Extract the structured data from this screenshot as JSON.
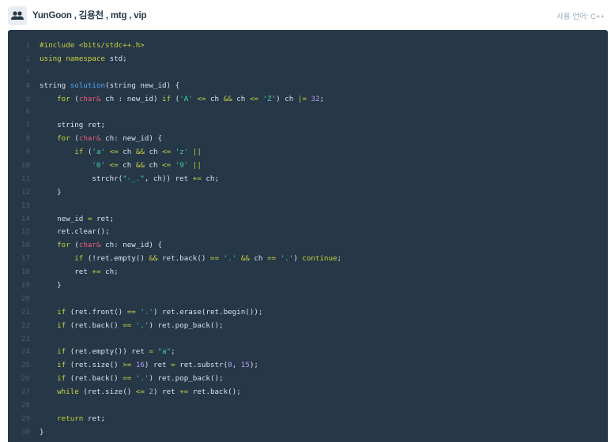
{
  "header": {
    "authors": "YunGoon , 김용천 , mtg , vip",
    "language_label": "사용 언어: C++"
  },
  "code": {
    "lines": [
      "#include <bits/stdc++.h>",
      "using namespace std;",
      "",
      "string solution(string new_id) {",
      "    for (char& ch : new_id) if ('A' <= ch && ch <= 'Z') ch |= 32;",
      "",
      "    string ret;",
      "    for (char& ch: new_id) {",
      "        if ('a' <= ch && ch <= 'z' ||",
      "            '0' <= ch && ch <= '9' ||",
      "            strchr(\"-_.\", ch)) ret += ch;",
      "    }",
      "",
      "    new_id = ret;",
      "    ret.clear();",
      "    for (char& ch: new_id) {",
      "        if (!ret.empty() && ret.back() == '.' && ch == '.') continue;",
      "        ret += ch;",
      "    }",
      "",
      "    if (ret.front() == '.') ret.erase(ret.begin());",
      "    if (ret.back() == '.') ret.pop_back();",
      "",
      "    if (ret.empty()) ret = \"a\";",
      "    if (ret.size() >= 16) ret = ret.substr(0, 15);",
      "    if (ret.back() == '.') ret.pop_back();",
      "    while (ret.size() <= 2) ret += ret.back();",
      "",
      "    return ret;",
      "}"
    ]
  },
  "icons": {
    "avatar": "users-icon"
  },
  "colors": {
    "code_background": "#263747",
    "keyword": "#c9d23f",
    "type": "#e45d76",
    "function": "#54a8f8",
    "string": "#44d4a8",
    "number": "#b59cf7"
  }
}
